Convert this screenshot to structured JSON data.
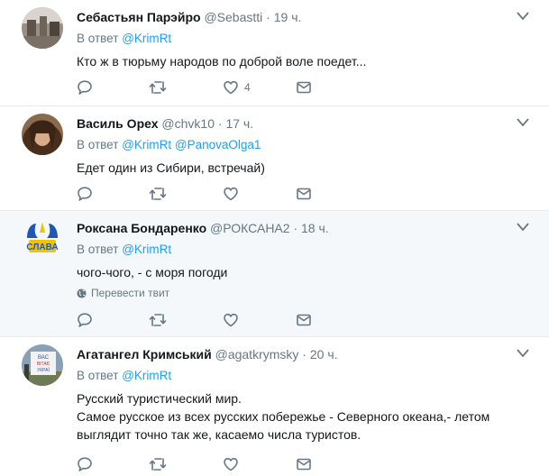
{
  "reply_prefix": "В ответ",
  "tweets": [
    {
      "name": "Себастьян Парэйро",
      "username": "@Sebastti",
      "dot": "·",
      "time": "19 ч.",
      "reply_to": [
        "@KrimRt"
      ],
      "text": [
        "Кто ж в тюрьму народов по доброй воле поедет..."
      ],
      "likes": "4"
    },
    {
      "name": "Василь Орех",
      "username": "@chvk10",
      "dot": "·",
      "time": "17 ч.",
      "reply_to": [
        "@KrimRt",
        "@PanovaOlga1"
      ],
      "text": [
        "Едет один из Сибири, встречай)"
      ],
      "likes": ""
    },
    {
      "name": "Роксана Бондаренко",
      "username": "@РОКСАНА2",
      "dot": "·",
      "time": "18 ч.",
      "reply_to": [
        "@KrimRt"
      ],
      "text": [
        "чого-чого, - с моря погоди"
      ],
      "translate": "Перевести твит",
      "likes": ""
    },
    {
      "name": "Агатангел Кримський",
      "username": "@agatkrymsky",
      "dot": "·",
      "time": "20 ч.",
      "reply_to": [
        "@KrimRt"
      ],
      "text": [
        "Русский туристический мир.",
        "Самое русское из всех русских побережье - Северного океана,- летом",
        "выглядит точно так же, касаемо числа туристов."
      ],
      "likes": ""
    }
  ],
  "colors": {
    "link": "#1da1f2",
    "muted": "#657786",
    "highlight_bg": "#f5f8fa",
    "divider": "#e6ecf0"
  },
  "icons": [
    "reply-icon",
    "retweet-icon",
    "like-icon",
    "direct-message-icon",
    "chevron-down-icon",
    "globe-icon"
  ]
}
